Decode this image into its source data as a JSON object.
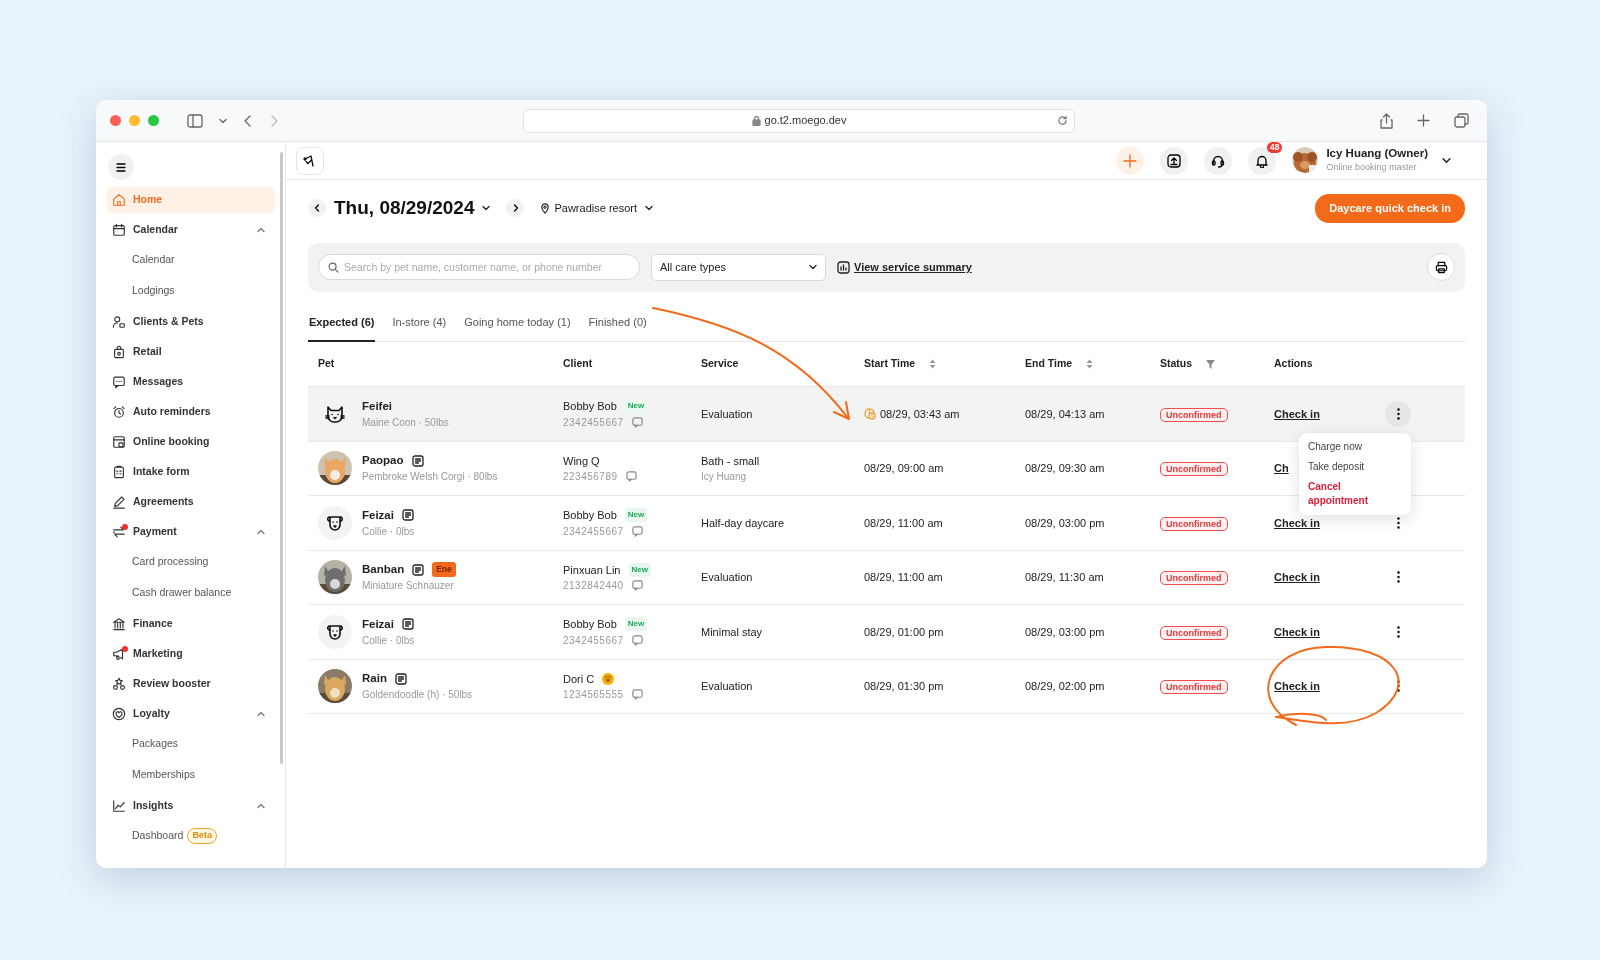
{
  "browser": {
    "url": "go.t2.moego.dev"
  },
  "sidebar": {
    "items": [
      {
        "label": "Home",
        "selected": true,
        "dot": false
      },
      {
        "label": "Calendar",
        "selected": false,
        "dot": false,
        "expanded": true,
        "children": [
          {
            "label": "Calendar",
            "selected": false
          },
          {
            "label": "Lodgings",
            "selected": false
          }
        ]
      },
      {
        "label": "Clients & Pets",
        "selected": false,
        "dot": false
      },
      {
        "label": "Retail",
        "selected": false,
        "dot": false
      },
      {
        "label": "Messages",
        "selected": false,
        "dot": false
      },
      {
        "label": "Auto reminders",
        "selected": false,
        "dot": false
      },
      {
        "label": "Online booking",
        "selected": false,
        "dot": false
      },
      {
        "label": "Intake form",
        "selected": false,
        "dot": false
      },
      {
        "label": "Agreements",
        "selected": false,
        "dot": false
      },
      {
        "label": "Payment",
        "selected": false,
        "dot": true,
        "expanded": true,
        "children": [
          {
            "label": "Card processing",
            "selected": false
          },
          {
            "label": "Cash drawer balance",
            "selected": false
          }
        ]
      },
      {
        "label": "Finance",
        "selected": false,
        "dot": false
      },
      {
        "label": "Marketing",
        "selected": false,
        "dot": true
      },
      {
        "label": "Review booster",
        "selected": false,
        "dot": false
      },
      {
        "label": "Loyalty",
        "selected": false,
        "dot": false,
        "expanded": true,
        "children": [
          {
            "label": "Packages",
            "selected": false
          },
          {
            "label": "Memberships",
            "selected": false
          }
        ]
      },
      {
        "label": "Insights",
        "selected": false,
        "dot": false,
        "expanded": true,
        "children": [
          {
            "label": "Dashboard",
            "selected": false,
            "badge": "Beta"
          }
        ]
      }
    ]
  },
  "header": {
    "notifications": "48",
    "user": {
      "name": "Icy Huang (Owner)",
      "role": "Online booking master"
    }
  },
  "date": "Thu, 08/29/2024",
  "location": "Pawradise resort",
  "primary_button": "Daycare quick check in",
  "filters": {
    "search": {
      "placeholder": "Search by pet name, customer name, or phone number"
    },
    "care_type": "All care types",
    "summary_link": "View service summary"
  },
  "tabs": [
    {
      "label": "Expected (6)",
      "selected": true
    },
    {
      "label": "In-store (4)",
      "selected": false
    },
    {
      "label": "Going home today (1)",
      "selected": false
    },
    {
      "label": "Finished (0)",
      "selected": false
    }
  ],
  "table": {
    "columns": [
      {
        "label": "Pet",
        "kind": "plain"
      },
      {
        "label": "Client",
        "kind": "plain"
      },
      {
        "label": "Service",
        "kind": "plain"
      },
      {
        "label": "Start Time",
        "kind": "sort"
      },
      {
        "label": "End Time",
        "kind": "sort"
      },
      {
        "label": "Status",
        "kind": "filter"
      },
      {
        "label": "Actions",
        "kind": "plain"
      }
    ],
    "rows": [
      {
        "highlighted": true,
        "pet": {
          "name": "Feifei",
          "breed": "Maine Coon · 50lbs",
          "avatar": {
            "kind": "cat"
          },
          "note": false
        },
        "client": {
          "name": "Bobby Bob",
          "phone": "2342455667",
          "badge": "New",
          "paw": false
        },
        "service": {
          "name": "Evaluation"
        },
        "start": "08/29, 03:43 am",
        "start_icon": true,
        "end": "08/29, 04:13 am",
        "status": "Unconfirmed",
        "action": "Check in",
        "more": true,
        "more_active": true,
        "menu": [
          {
            "label": "Charge now",
            "kind": "normal"
          },
          {
            "label": "Take deposit",
            "kind": "normal"
          },
          {
            "label": "Cancel appointment",
            "kind": "danger"
          }
        ]
      },
      {
        "highlighted": false,
        "pet": {
          "name": "Paopao",
          "breed": "Pembroke Welsh Corgi · 80lbs",
          "note": true
        },
        "client": {
          "name": "Wing Q",
          "phone": "223456789",
          "paw": false
        },
        "service": {
          "name": "Bath - small",
          "staff": "Icy Huang"
        },
        "start": "08/29, 09:00 am",
        "start_icon": false,
        "end": "08/29, 09:30 am",
        "status": "Unconfirmed",
        "action": "Ch",
        "more": false
      },
      {
        "highlighted": false,
        "pet": {
          "name": "Feizai",
          "breed": "Collie · 0lbs",
          "avatar": {
            "kind": "dog"
          },
          "note": true
        },
        "client": {
          "name": "Bobby Bob",
          "phone": "2342455667",
          "badge": "New",
          "paw": false
        },
        "service": {
          "name": "Half-day daycare"
        },
        "start": "08/29, 11:00 am",
        "start_icon": false,
        "end": "08/29, 03:00 pm",
        "status": "Unconfirmed",
        "action": "Check in",
        "more": true,
        "more_active": false
      },
      {
        "highlighted": false,
        "pet": {
          "name": "Banban",
          "breed": "Miniature Schnauzer",
          "note": true,
          "tag": "Ene"
        },
        "client": {
          "name": "Pinxuan Lin",
          "phone": "2132842440",
          "badge": "New",
          "paw": false
        },
        "service": {
          "name": "Evaluation"
        },
        "start": "08/29, 11:00 am",
        "start_icon": false,
        "end": "08/29, 11:30 am",
        "status": "Unconfirmed",
        "action": "Check in",
        "more": true,
        "more_active": false
      },
      {
        "highlighted": false,
        "pet": {
          "name": "Feizai",
          "breed": "Collie · 0lbs",
          "avatar": {
            "kind": "dog"
          },
          "note": true
        },
        "client": {
          "name": "Bobby Bob",
          "phone": "2342455667",
          "badge": "New",
          "paw": false
        },
        "service": {
          "name": "Minimal stay"
        },
        "start": "08/29, 01:00 pm",
        "start_icon": false,
        "end": "08/29, 03:00 pm",
        "status": "Unconfirmed",
        "action": "Check in",
        "more": true,
        "more_active": false
      },
      {
        "highlighted": false,
        "pet": {
          "name": "Rain",
          "breed": "Goldendoodle (h) · 50lbs",
          "note": true
        },
        "client": {
          "name": "Dori C",
          "phone": "1234565555",
          "paw": true
        },
        "service": {
          "name": "Evaluation"
        },
        "start": "08/29, 01:30 pm",
        "start_icon": false,
        "end": "08/29, 02:00 pm",
        "status": "Unconfirmed",
        "action": "Check in",
        "more": true,
        "more_active": false
      }
    ]
  },
  "annotations": {
    "arrow": true,
    "ellipse": true
  }
}
